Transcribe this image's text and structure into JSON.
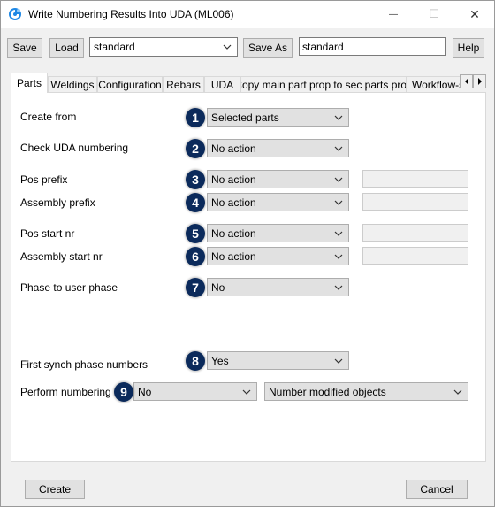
{
  "window": {
    "title": "Write Numbering Results Into UDA (ML006)",
    "minimize_glyph": "—",
    "maximize_glyph": "☐",
    "close_glyph": "✕"
  },
  "toolbar": {
    "save_label": "Save",
    "load_label": "Load",
    "preset_value": "standard",
    "save_as_label": "Save As",
    "save_as_value": "standard",
    "help_label": "Help"
  },
  "tabs": [
    {
      "label": "Parts",
      "active": true
    },
    {
      "label": "Weldings"
    },
    {
      "label": "Configuration"
    },
    {
      "label": "Rebars"
    },
    {
      "label": "UDA"
    },
    {
      "label": "Copy main part prop to sec parts prop"
    },
    {
      "label": "Workflow-s"
    }
  ],
  "rows": [
    {
      "label": "Create from",
      "badge": "1",
      "value": "Selected parts"
    },
    {
      "label": "Check  UDA numbering",
      "badge": "2",
      "value": "No action"
    },
    {
      "label": "Pos prefix",
      "badge": "3",
      "value": "No action"
    },
    {
      "label": "Assembly prefix",
      "badge": "4",
      "value": "No action"
    },
    {
      "label": "Pos start nr",
      "badge": "5",
      "value": "No action"
    },
    {
      "label": "Assembly start nr",
      "badge": "6",
      "value": "No action"
    },
    {
      "label": "Phase to user phase",
      "badge": "7",
      "value": "No"
    },
    {
      "label": "First synch phase numbers",
      "badge": "8",
      "value": "Yes"
    },
    {
      "label": "Perform numbering",
      "badge": "9",
      "value": "No",
      "secondary_value": "Number modified objects"
    }
  ],
  "footer": {
    "create_label": "Create",
    "cancel_label": "Cancel"
  },
  "colors": {
    "badge": "#0b2a5b",
    "app_icon": "#1e88e5"
  },
  "icons": [
    "app-icon",
    "minimize-icon",
    "maximize-icon",
    "close-icon",
    "chevron-down-icon",
    "tab-scroll-left-icon",
    "tab-scroll-right-icon"
  ]
}
